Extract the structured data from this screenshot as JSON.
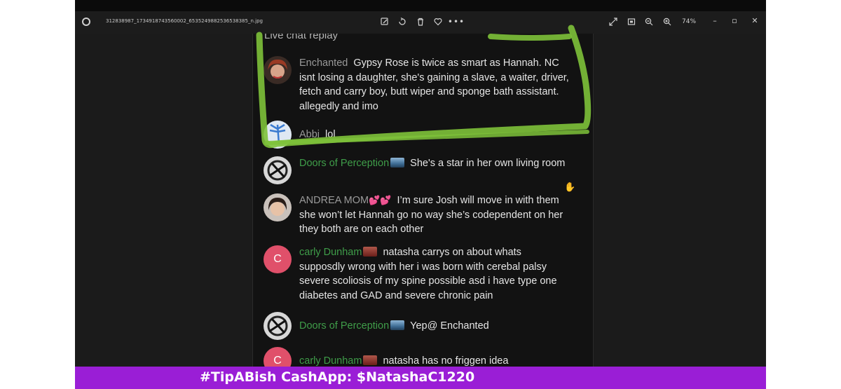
{
  "window": {
    "filename": "312838987_1734918743560002_6535249882536538385_n.jpg",
    "zoom": "74%",
    "toolbar_icons": [
      "edit-icon",
      "rotate-icon",
      "delete-icon",
      "favorite-icon",
      "more-icon"
    ],
    "right_icons": [
      "fullscreen-icon",
      "fit-icon",
      "zoom-out-icon",
      "zoom-in-icon"
    ],
    "controls": {
      "minimize": "–",
      "maximize": "▫",
      "close": "✕"
    }
  },
  "chat": {
    "header": "Live chat replay",
    "messages": [
      {
        "author": "Enchanted",
        "member": false,
        "text": "Gypsy Rose is twice as smart as Hannah. NC isnt losing a daughter, she's gaining a slave, a waiter, driver, fetch and carry boy, butt wiper and sponge bath assistant. allegedly and imo"
      },
      {
        "author": "Abbi",
        "member": false,
        "text": "lol"
      },
      {
        "author": "Doors of Perception",
        "member": true,
        "text": "She's a star in her own living room"
      },
      {
        "author": "ANDREA MOM",
        "member": false,
        "hearts": "💕💕",
        "text": "I’m sure Josh will move in with them she won’t let Hannah go no way she’s codependent on her they both are on each other"
      },
      {
        "author": "carly Dunham",
        "member": true,
        "avatar_letter": "C",
        "text": "natasha carrys on about whats supposdly wrong with her i was born with cerebal palsy severe scoliosis of my spine possible asd i have type one diabetes and GAD and severe chronic pain"
      },
      {
        "author": "Doors of Perception",
        "member": true,
        "text": "Yep@ Enchanted"
      },
      {
        "author": "carly Dunham",
        "member": true,
        "avatar_letter": "C",
        "text": "natasha has no friggen idea"
      }
    ]
  },
  "banner": {
    "text": "#TipABish CashApp: $NatashaC1220"
  },
  "colors": {
    "highlight": "#7ec23a",
    "banner": "#9a1ed6",
    "member_name": "#3f9d49"
  }
}
